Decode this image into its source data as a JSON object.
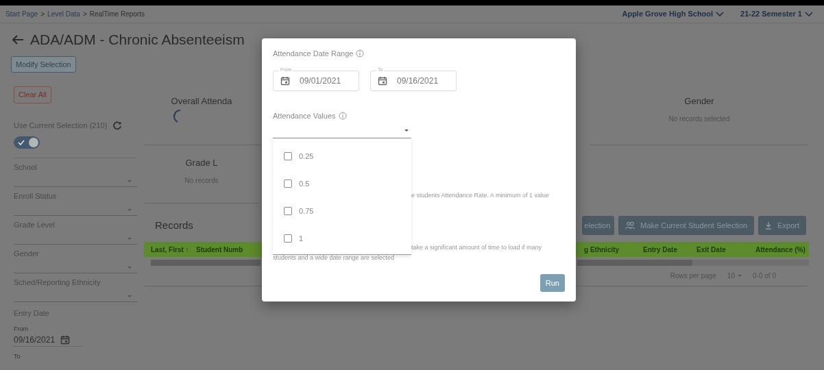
{
  "breadcrumb": [
    {
      "label": "Start Page",
      "link": true
    },
    {
      "label": ">",
      "link": false
    },
    {
      "label": "Level Data",
      "link": true
    },
    {
      "label": ">",
      "link": false
    },
    {
      "label": "RealTime Reports",
      "link": false
    }
  ],
  "top_menus": [
    {
      "label": "Apple Grove High School"
    },
    {
      "label": "21-22 Semester 1"
    }
  ],
  "page_title": "ADA/ADM - Chronic Absenteeism",
  "modify_button": "Modify Selection",
  "sidebar": {
    "clear_button": "Clear All",
    "current_selection": {
      "label": "Use Current Selection (210)",
      "on": true
    },
    "filters": [
      {
        "label": "School"
      },
      {
        "label": "Enroll Status"
      },
      {
        "label": "Grade Level"
      },
      {
        "label": "Gender"
      },
      {
        "label": "Sched/Reporting Ethnicity"
      }
    ],
    "entry_date": {
      "label": "Entry Date",
      "from_label": "From",
      "from_value": "09/16/2021",
      "to_label": "To"
    }
  },
  "cards": [
    {
      "title": "Overall Attenda",
      "loading": true
    },
    {
      "title": "Gender",
      "loading": false,
      "note": "No records selected"
    },
    {
      "title": "Grade L",
      "loading": false,
      "note": "No records"
    }
  ],
  "records": {
    "title": "Records",
    "buttons": [
      {
        "label": "election",
        "kind": "plain"
      },
      {
        "label": "Make Current Student Selection",
        "kind": "people"
      },
      {
        "label": "Export",
        "kind": "download"
      }
    ],
    "columns": [
      "Last, First ↑",
      "Student Numb",
      "g Ethnicity",
      "Entry Date",
      "Exit Date",
      "Attendance (%)"
    ],
    "rows_per_page_label": "Rows per page",
    "rows_per_page": "10",
    "range": "0-0 of 0"
  },
  "dialog": {
    "date_range_label": "Attendance Date Range",
    "from_label": "From",
    "from_value": "09/01/2021",
    "to_label": "To",
    "to_value": "09/16/2021",
    "values_label": "Attendance Values",
    "options": [
      {
        "label": "0.25",
        "checked": false
      },
      {
        "label": "0.5",
        "checked": false
      },
      {
        "label": "0.75",
        "checked": false
      },
      {
        "label": "1",
        "checked": false
      }
    ],
    "note_1": "e students Attendance Rate. A minimum of 1 value",
    "note_2a": "take a significant amount of time to load if many",
    "note_2b": "students and a wide date range are selected",
    "run_button": "Run"
  }
}
